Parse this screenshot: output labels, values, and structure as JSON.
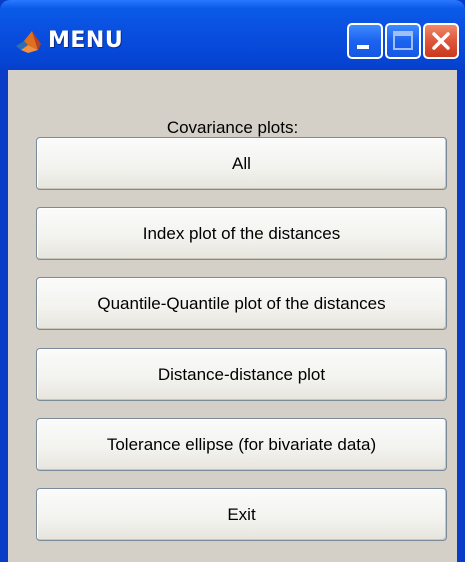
{
  "window": {
    "title": "MENU",
    "controls": {
      "minimize": "minimize-icon",
      "maximize": "maximize-icon",
      "close": "close-icon"
    }
  },
  "caption": "Covariance plots:",
  "buttons": [
    {
      "label": "All"
    },
    {
      "label": "Index plot of the distances"
    },
    {
      "label": "Quantile-Quantile plot of the distances"
    },
    {
      "label": "Distance-distance plot"
    },
    {
      "label": "Tolerance ellipse (for bivariate data)"
    },
    {
      "label": "Exit"
    }
  ],
  "colors": {
    "titlebar": "#0a4fe0",
    "client_background": "#d4d0c8",
    "close_button": "#e0553a"
  }
}
